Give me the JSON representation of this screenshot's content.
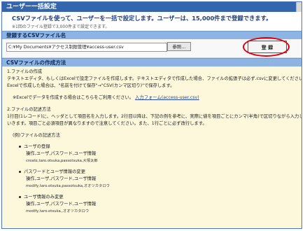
{
  "window": {
    "title": "ユーザー一括設定"
  },
  "intro": {
    "main": "CSVファイルを使って、ユーザーを一括で設定します。ユーザーは、15,000件まで登録できます。",
    "note": "※1回のファイル登録で3,000件まで設定できます。"
  },
  "upload": {
    "header": "登録するCSVファイル名",
    "file_value": "C:¥My Documents¥アクセス制限管理¥access-user.csv",
    "browse_label": "参照...",
    "register_label": "登 録"
  },
  "guide": {
    "header": "CSVファイルの作成方法",
    "step1_title": "1.ファイルの作成",
    "step1_line1": "テキストエディタ、もしくはExcelで設定ファイルを作成します。テキストエディタで作成した場合、ファイルの拡張子は必ず.csvに変更してください。",
    "step1_line2": "Excelで作成した場合は、\"名前を付けて保存\"→\"CSV(カンマ区切り)\"で保存します。",
    "excel_note": "※Excelでデータを作成する場合はこちらをご利用ください。",
    "link_text": "入力フォーム(access-user.csv)",
    "step2_title": "2.ファイルの記述方法",
    "step2_line1": "1行目(1レコード)に、ヘッダとして項目名を入力します。2行目以降は、下記の例を参考に、実際に値を項目ごとにカンマ(半角)で区切りながら入力して",
    "step2_line2": "いきます。項目ごと必須項目が異なりますので注意してください。また、1行ごとに必ず改行します。",
    "example_title": "(例)ファイルの記述方法",
    "items": [
      {
        "title": "ユーザの登録",
        "desc": "操作,ユーザ,パスワード,ユーザ情報",
        "example": "create,taro.otsuka,passotsuka,大塚太郎"
      },
      {
        "title": "パスワードとユーザ情報の変更",
        "desc": "操作,ユーザ,パスワード,ユーザ情報",
        "example": "modify,taro.otsuka,passotsuka,オオツカタロウ"
      },
      {
        "title": "ユーザ情報のみ変更",
        "desc": "操作,ユーザ,パスワード,ユーザ情報",
        "example": "modify,taro.otsuka,,オオツカタロウ"
      }
    ]
  }
}
